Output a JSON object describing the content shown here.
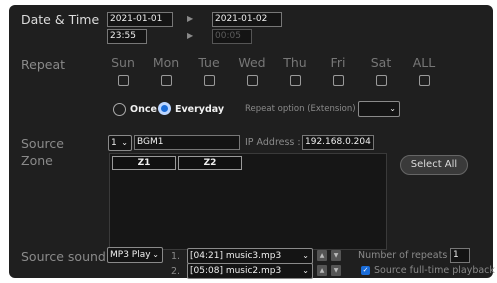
{
  "labels": {
    "date_time": "Date & Time",
    "repeat": "Repeat",
    "source": "Source",
    "zone": "Zone",
    "source_sound": "Source sound"
  },
  "datetime": {
    "start_date": "2021-01-01",
    "end_date": "2021-01-02",
    "start_time": "23:55",
    "end_time": "00:05"
  },
  "days": [
    "Sun",
    "Mon",
    "Tue",
    "Wed",
    "Thu",
    "Fri",
    "Sat",
    "ALL"
  ],
  "repeat_mode": {
    "once": "Once",
    "everyday": "Everyday",
    "selected": "everyday",
    "extension_label": "Repeat option (Extension)",
    "extension_value": ""
  },
  "source": {
    "number": "1",
    "name": "BGM1",
    "ip_label": "IP Address :",
    "ip_value": "192.168.0.204"
  },
  "zones": [
    "Z1",
    "Z2"
  ],
  "select_all": "Select All",
  "sound": {
    "mode": "MP3 Play",
    "tracks": [
      {
        "index": "1.",
        "value": "[04:21] music3.mp3"
      },
      {
        "index": "2.",
        "value": "[05:08] music2.mp3"
      }
    ],
    "repeats_label": "Number of repeats",
    "repeats_value": "1",
    "fulltime_label": "Source full-time playback",
    "fulltime_checked": true
  },
  "icons": {
    "play": "play-arrow-icon",
    "up": "arrow-up-icon",
    "down": "arrow-down-icon",
    "chevron": "chevron-down-icon",
    "check": "checkmark-icon"
  },
  "colors": {
    "panel_bg": "#1f1f1f",
    "accent": "#1a6cd8"
  }
}
